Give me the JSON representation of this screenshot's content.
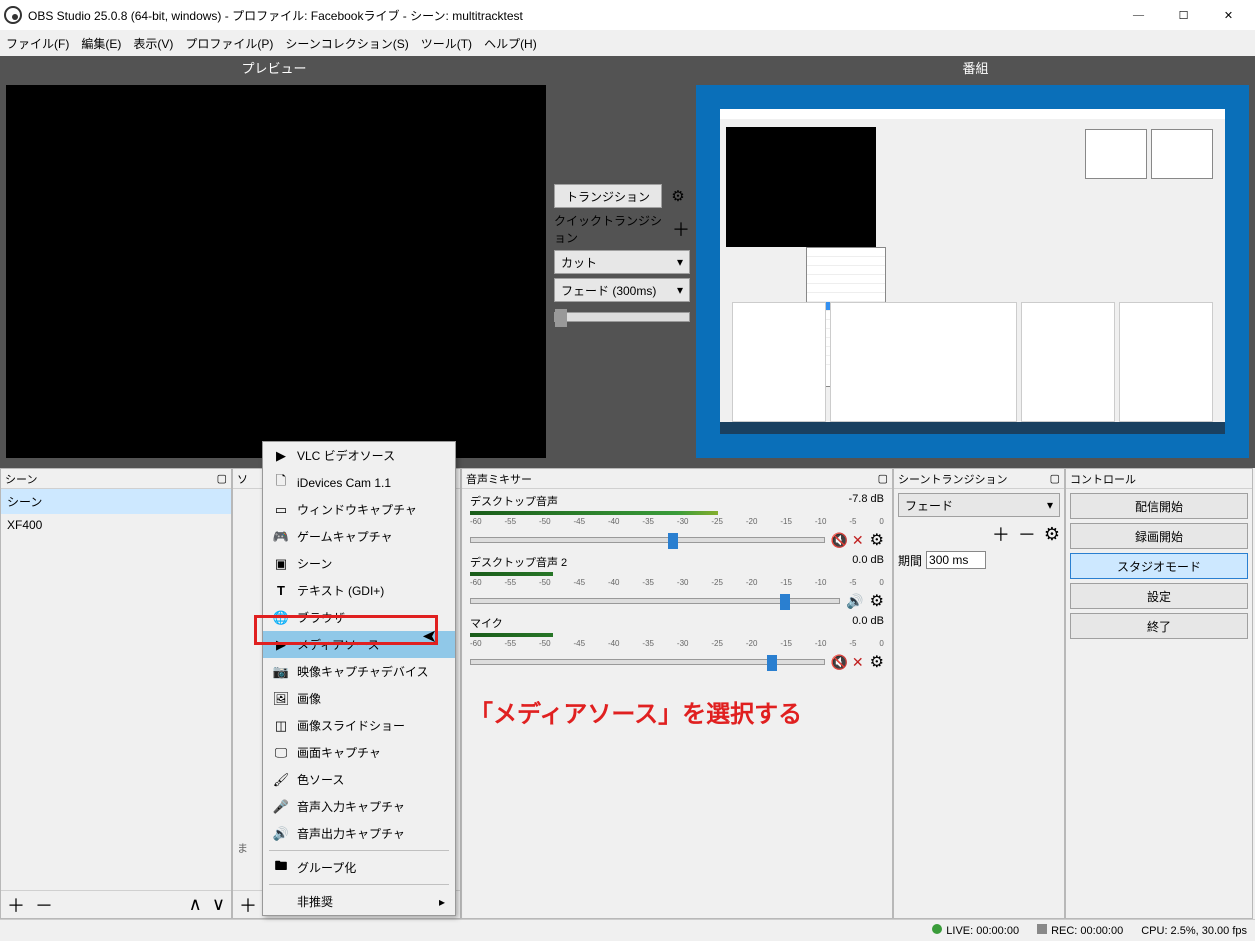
{
  "window": {
    "title": "OBS Studio 25.0.8 (64-bit, windows) - プロファイル: Facebookライブ - シーン: multitracktest"
  },
  "menu": {
    "file": "ファイル(F)",
    "edit": "編集(E)",
    "view": "表示(V)",
    "profile": "プロファイル(P)",
    "scene_collection": "シーンコレクション(S)",
    "tools": "ツール(T)",
    "help": "ヘルプ(H)"
  },
  "preview": {
    "label": "プレビュー"
  },
  "program": {
    "label": "番組"
  },
  "transition": {
    "button": "トランジション",
    "quick_label": "クイックトランジション",
    "cut": "カット",
    "fade": "フェード (300ms)"
  },
  "scenes": {
    "title": "シーン",
    "items": [
      "シーン",
      "XF400"
    ]
  },
  "sources": {
    "title": "ソース"
  },
  "mixer": {
    "title": "音声ミキサー",
    "channels": [
      {
        "name": "デスクトップ音声",
        "db": "-7.8 dB"
      },
      {
        "name": "デスクトップ音声 2",
        "db": "0.0 dB"
      },
      {
        "name": "マイク",
        "db": "0.0 dB"
      }
    ],
    "scale": [
      "-60",
      "-55",
      "-50",
      "-45",
      "-40",
      "-35",
      "-30",
      "-25",
      "-20",
      "-15",
      "-10",
      "-5",
      "0"
    ]
  },
  "scene_trans": {
    "title": "シーントランジション",
    "value": "フェード",
    "duration_label": "期間",
    "duration": "300 ms"
  },
  "controls": {
    "title": "コントロール",
    "buttons": {
      "stream": "配信開始",
      "record": "録画開始",
      "studio": "スタジオモード",
      "settings": "設定",
      "exit": "終了"
    }
  },
  "context_menu": {
    "items": [
      "VLC ビデオソース",
      "iDevices Cam 1.1",
      "ウィンドウキャプチャ",
      "ゲームキャプチャ",
      "シーン",
      "テキスト (GDI+)",
      "ブラウザ",
      "メディアソース",
      "映像キャプチャデバイス",
      "画像",
      "画像スライドショー",
      "画面キャプチャ",
      "色ソース",
      "音声入力キャプチャ",
      "音声出力キャプチャ"
    ],
    "group": "グループ化",
    "deprecated": "非推奨"
  },
  "annotation": "「メディアソース」を選択する",
  "status": {
    "live": "LIVE: 00:00:00",
    "rec": "REC: 00:00:00",
    "cpu": "CPU: 2.5%, 30.00 fps"
  }
}
